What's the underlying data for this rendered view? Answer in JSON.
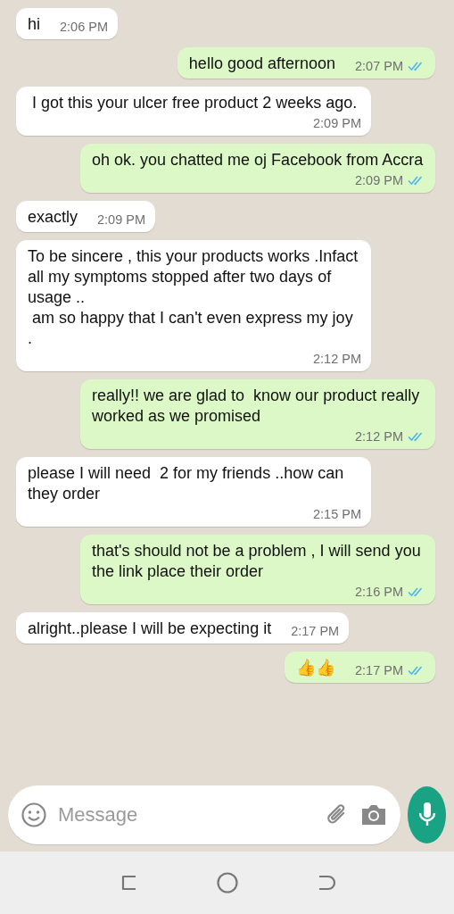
{
  "messages": [
    {
      "kind": "incoming",
      "text": "hi",
      "time": "2:06 PM"
    },
    {
      "kind": "outgoing",
      "text": "hello good afternoon",
      "time": "2:07 PM",
      "read": true
    },
    {
      "kind": "incoming",
      "text": " I got this your ulcer free product 2 weeks ago.",
      "time": "2:09 PM"
    },
    {
      "kind": "outgoing",
      "text": "oh ok. you chatted me oj Facebook from Accra",
      "time": "2:09 PM",
      "read": true
    },
    {
      "kind": "incoming",
      "text": "exactly",
      "time": "2:09 PM"
    },
    {
      "kind": "incoming",
      "text": "To be sincere , this your products works .Infact all my symptoms stopped after two days of usage ..\n am so happy that I can't even express my joy .",
      "time": "2:12 PM"
    },
    {
      "kind": "outgoing",
      "text": "really!! we are glad to  know our product really worked as we promised",
      "time": "2:12 PM",
      "read": true
    },
    {
      "kind": "incoming",
      "text": "please I will need  2 for my friends ..how can they order",
      "time": "2:15 PM"
    },
    {
      "kind": "outgoing",
      "text": "that's should not be a problem , I will send you the link place their order",
      "time": "2:16 PM",
      "read": true
    },
    {
      "kind": "incoming",
      "text": "alright..please I will be expecting it",
      "time": "2:17 PM"
    },
    {
      "kind": "outgoing",
      "text": "👍👍",
      "time": "2:17 PM",
      "read": true
    }
  ],
  "composer": {
    "placeholder": "Message"
  }
}
